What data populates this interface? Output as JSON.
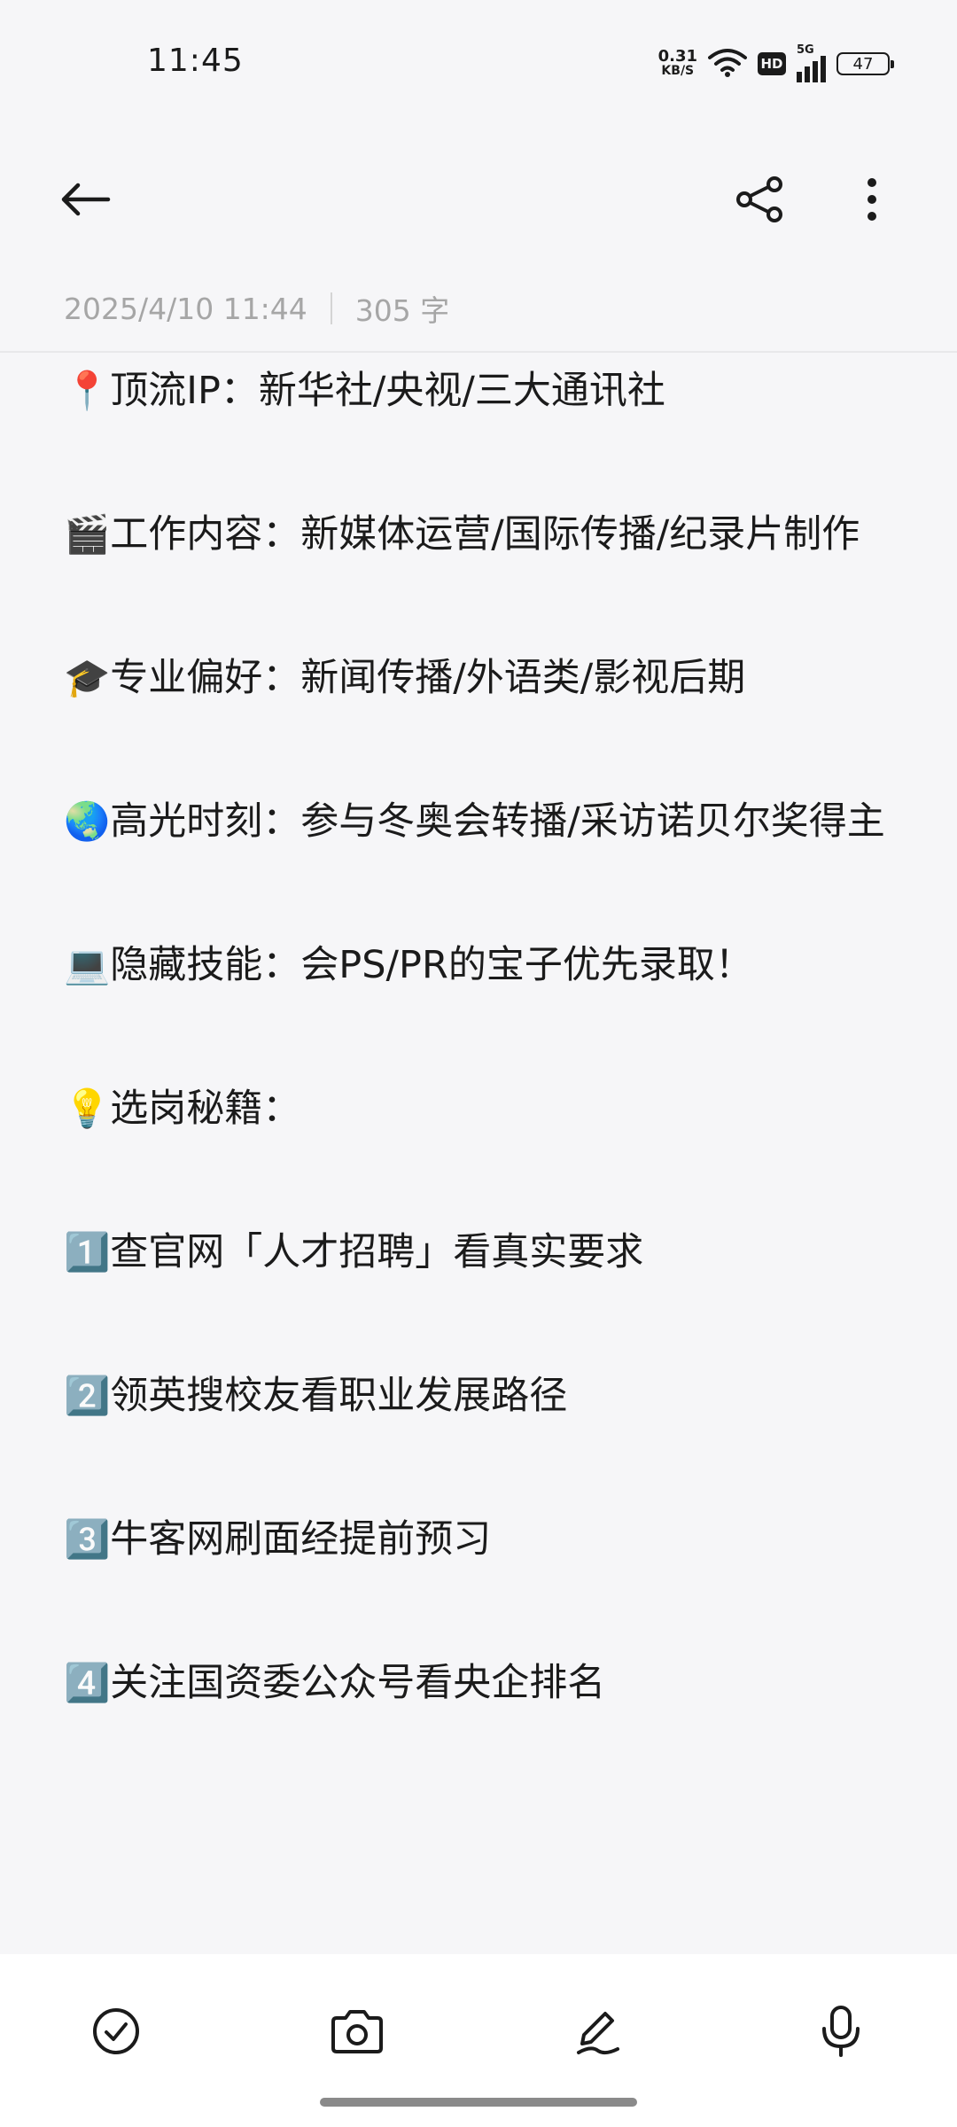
{
  "status_bar": {
    "time": "11:45",
    "net_speed_value": "0.31",
    "net_speed_unit": "KB/S",
    "hd": "HD",
    "signal_type": "5G",
    "battery": "47"
  },
  "toolbar": {
    "back_icon": "arrow-left-icon",
    "share_icon": "share-icon",
    "more_icon": "more-vertical-icon"
  },
  "meta": {
    "datetime": "2025/4/10 11:44",
    "word_count": "305 字"
  },
  "note": {
    "paragraphs": [
      {
        "emoji": "📍",
        "text": "顶流IP：新华社/央视/三大通讯社"
      },
      {
        "emoji": "🎬",
        "text": "工作内容：新媒体运营/国际传播/纪录片制作"
      },
      {
        "emoji": "🎓",
        "text": "专业偏好：新闻传播/外语类/影视后期"
      },
      {
        "emoji": "🌏",
        "text": "高光时刻：参与冬奥会转播/采访诺贝尔奖得主"
      },
      {
        "emoji": "💻",
        "text": "隐藏技能：会PS/PR的宝子优先录取！"
      },
      {
        "emoji": "💡",
        "text": "选岗秘籍："
      },
      {
        "emoji": "1️⃣",
        "text": "查官网「人才招聘」看真实要求"
      },
      {
        "emoji": "2️⃣",
        "text": "领英搜校友看职业发展路径"
      },
      {
        "emoji": "3️⃣",
        "text": "牛客网刷面经提前预习"
      },
      {
        "emoji": "4️⃣",
        "text": "关注国资委公众号看央企排名"
      }
    ]
  },
  "bottom_bar": {
    "items": [
      "checklist-icon",
      "camera-icon",
      "handwriting-pen-icon",
      "microphone-icon"
    ]
  }
}
